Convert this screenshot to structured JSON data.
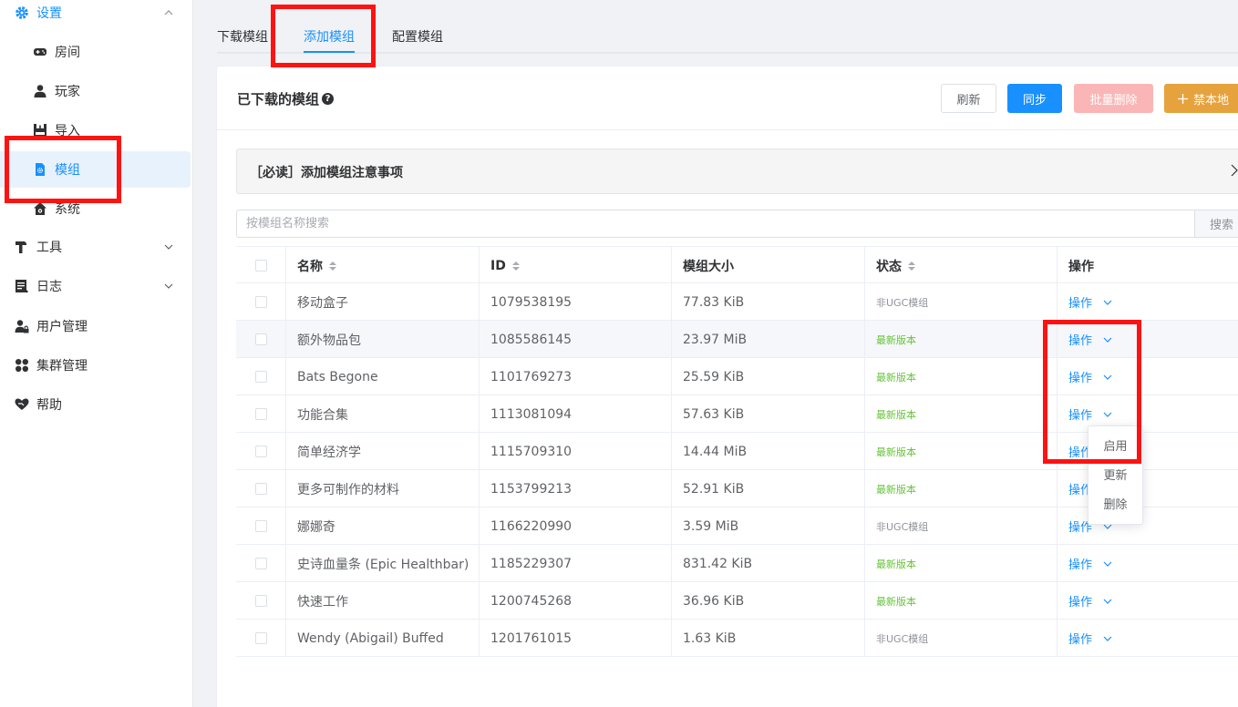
{
  "sidebar": {
    "settings_label": "设置",
    "sub_items": [
      "房间",
      "玩家",
      "导入",
      "模组",
      "系统"
    ],
    "top_items": [
      "工具",
      "日志",
      "用户管理",
      "集群管理",
      "帮助"
    ]
  },
  "tabs": [
    "下载模组",
    "添加模组",
    "配置模组"
  ],
  "card": {
    "title": "已下载的模组",
    "help": "?",
    "buttons": {
      "refresh": "刷新",
      "sync": "同步",
      "batch_delete": "批量删除",
      "ban_local": "禁本地"
    }
  },
  "notice": "［必读］添加模组注意事项",
  "search": {
    "placeholder": "按模组名称搜索",
    "button": "搜索"
  },
  "table": {
    "headers": [
      "名称",
      "ID",
      "模组大小",
      "状态",
      "操作"
    ],
    "rows": [
      {
        "name": "移动盒子",
        "id": "1079538195",
        "size": "77.83 KiB",
        "status": "非UGC模组",
        "status_type": "nonugc",
        "op": "操作"
      },
      {
        "name": "额外物品包",
        "id": "1085586145",
        "size": "23.97 MiB",
        "status": "最新版本",
        "status_type": "latest",
        "op": "操作"
      },
      {
        "name": "Bats Begone",
        "id": "1101769273",
        "size": "25.59 KiB",
        "status": "最新版本",
        "status_type": "latest",
        "op": "操作"
      },
      {
        "name": "功能合集",
        "id": "1113081094",
        "size": "57.63 KiB",
        "status": "最新版本",
        "status_type": "latest",
        "op": "操作"
      },
      {
        "name": "简单经济学",
        "id": "1115709310",
        "size": "14.44 MiB",
        "status": "最新版本",
        "status_type": "latest",
        "op": "操作"
      },
      {
        "name": "更多可制作的材料",
        "id": "1153799213",
        "size": "52.91 KiB",
        "status": "最新版本",
        "status_type": "latest",
        "op": "操作"
      },
      {
        "name": "娜娜奇",
        "id": "1166220990",
        "size": "3.59 MiB",
        "status": "非UGC模组",
        "status_type": "nonugc",
        "op": "操作"
      },
      {
        "name": "史诗血量条 (Epic Healthbar)",
        "id": "1185229307",
        "size": "831.42 KiB",
        "status": "最新版本",
        "status_type": "latest",
        "op": "操作"
      },
      {
        "name": "快速工作",
        "id": "1200745268",
        "size": "36.96 KiB",
        "status": "最新版本",
        "status_type": "latest",
        "op": "操作"
      },
      {
        "name": "Wendy (Abigail) Buffed",
        "id": "1201761015",
        "size": "1.63 KiB",
        "status": "非UGC模组",
        "status_type": "nonugc",
        "op": "操作"
      }
    ]
  },
  "dropdown": [
    "启用",
    "更新",
    "删除"
  ],
  "colors": {
    "primary": "#1890ff",
    "latest": "#67c23a",
    "highlight": "#ff1212",
    "warning": "#e6a23c"
  }
}
